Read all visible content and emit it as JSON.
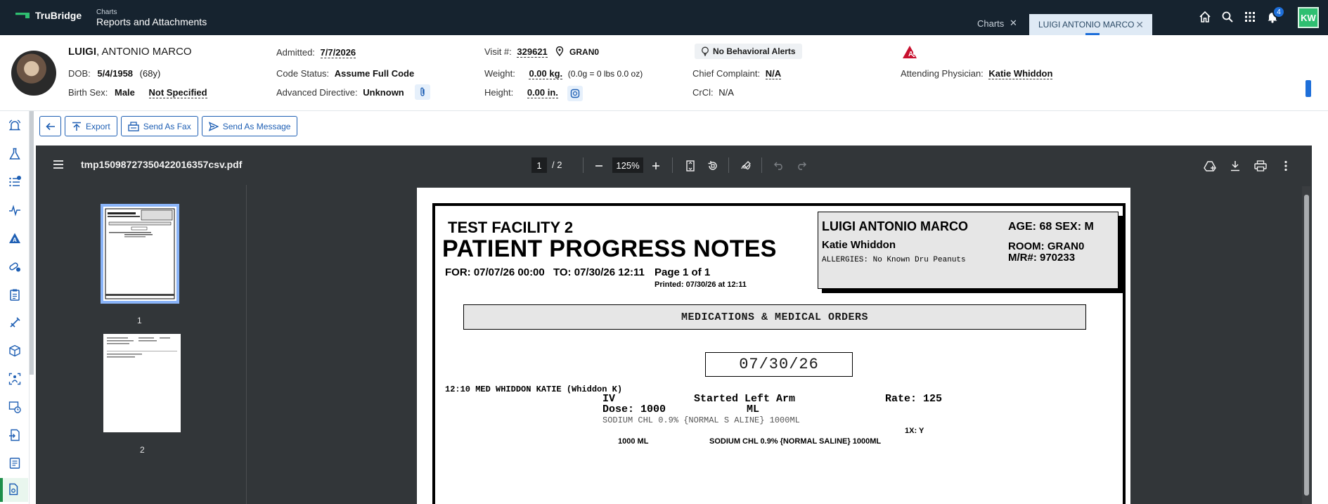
{
  "app": {
    "brand": "TruBridge",
    "breadcrumb": "Charts",
    "title": "Reports and Attachments",
    "tabs": [
      {
        "label": "Charts",
        "close": "✕"
      },
      {
        "label": "LUIGI ANTONIO MARCO",
        "close": "✕"
      }
    ],
    "notification_count": "4",
    "user_initials": "KW"
  },
  "patient": {
    "last_name": "LUIGI",
    "first_middle": ", ANTONIO MARCO",
    "dob_label": "DOB:",
    "dob": "5/4/1958",
    "age": "(68y)",
    "birth_sex_label": "Birth Sex:",
    "birth_sex": "Male",
    "gender_identity": "Not Specified",
    "admitted_label": "Admitted:",
    "admitted": "7/7/2026",
    "code_status_label": "Code Status:",
    "code_status": "Assume Full Code",
    "adv_directive_label": "Advanced Directive:",
    "adv_directive": "Unknown",
    "visit_label": "Visit #:",
    "visit": "329621",
    "location": "GRAN0",
    "weight_label": "Weight:",
    "weight": "0.00 kg.",
    "weight_conv": "(0.0g = 0 lbs 0.0 oz)",
    "height_label": "Height:",
    "height": "0.00 in.",
    "behavioral_alerts": "No Behavioral Alerts",
    "chief_complaint_label": "Chief Complaint:",
    "chief_complaint": "N/A",
    "crcl_label": "CrCl:",
    "crcl": "N/A",
    "attending_label": "Attending Physician:",
    "attending": "Katie Whiddon"
  },
  "toolbar": {
    "export_label": "Export",
    "fax_label": "Send As Fax",
    "message_label": "Send As Message"
  },
  "viewer": {
    "filename": "tmp15098727350422016357csv.pdf",
    "current_page": "1",
    "page_total": "/  2",
    "zoom": "125%",
    "thumb_labels": [
      "1",
      "2"
    ]
  },
  "document": {
    "facility": "TEST FACILITY 2",
    "title": "PATIENT PROGRESS NOTES",
    "for": "FOR: 07/07/26 00:00",
    "to": "TO: 07/30/26 12:11",
    "page": "Page  1  of   1",
    "printed": "Printed: 07/30/26 at 12:11",
    "patient_name": "LUIGI ANTONIO MARCO",
    "age_sex": "AGE:   68   SEX:  M",
    "physician": "Katie Whiddon",
    "room": "ROOM: GRAN0",
    "mr": "M/R#: 970233",
    "allergies": "ALLERGIES: No Known Dru Peanuts",
    "section": "MEDICATIONS & MEDICAL ORDERS",
    "date": "07/30/26",
    "entry_time": "12:10 MED WHIDDON KATIE  (Whiddon K)",
    "iv": "IV",
    "started": "Started  Left Arm",
    "rate": "Rate: 125",
    "dose": "Dose: 1000",
    "unit": "ML",
    "drug_line": "SODIUM CHL 0.9% {NORMAL S ALINE} 1000ML",
    "freq": "1X: Y",
    "qty": "1000 ML",
    "drug_line2": "SODIUM CHL 0.9% {NORMAL SALINE} 1000ML"
  }
}
